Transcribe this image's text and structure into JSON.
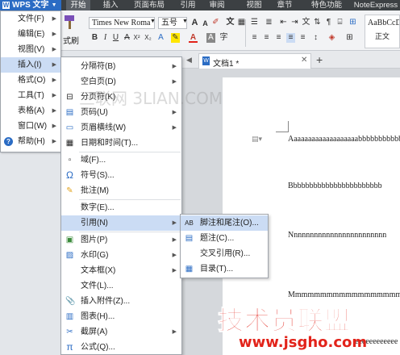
{
  "app": {
    "name": "WPS 文字",
    "logo": "W"
  },
  "ribbon_tabs": [
    "开始",
    "插入",
    "页面布局",
    "引用",
    "审阅",
    "视图",
    "章节",
    "特色功能",
    "NoteExpress"
  ],
  "toolbar": {
    "font": "Times New Roma",
    "size": "五号",
    "format_painter": "式刷",
    "style_name": "AaBbCcD",
    "style_label": "正文"
  },
  "main_menu": [
    {
      "label": "文件(F)",
      "arrow": true
    },
    {
      "label": "编辑(E)",
      "arrow": true
    },
    {
      "label": "视图(V)",
      "arrow": true
    },
    {
      "label": "插入(I)",
      "arrow": true,
      "active": true
    },
    {
      "label": "格式(O)",
      "arrow": true
    },
    {
      "label": "工具(T)",
      "arrow": true
    },
    {
      "label": "表格(A)",
      "arrow": true
    },
    {
      "label": "窗口(W)",
      "arrow": true
    },
    {
      "label": "帮助(H)",
      "arrow": true
    }
  ],
  "insert_menu": [
    {
      "label": "分隔符(B)",
      "arrow": true,
      "icon": ""
    },
    {
      "label": "空白页(D)",
      "arrow": true,
      "icon": ""
    },
    {
      "label": "分页符(K)",
      "arrow": false,
      "icon": "page-break-icon"
    },
    {
      "label": "页码(U)",
      "arrow": true,
      "icon": "page-number-icon"
    },
    {
      "label": "页眉横线(W)",
      "arrow": true,
      "icon": "header-line-icon"
    },
    {
      "label": "日期和时间(T)...",
      "arrow": false,
      "icon": "datetime-icon"
    },
    {
      "label": "域(F)...",
      "arrow": false,
      "icon": "field-icon"
    },
    {
      "label": "符号(S)...",
      "arrow": false,
      "icon": "omega-icon"
    },
    {
      "label": "批注(M)",
      "arrow": false,
      "icon": "comment-icon"
    },
    {
      "label": "数字(E)...",
      "arrow": false,
      "icon": ""
    },
    {
      "label": "引用(N)",
      "arrow": true,
      "icon": "",
      "active": true
    },
    {
      "label": "图片(P)",
      "arrow": true,
      "icon": "picture-icon"
    },
    {
      "label": "水印(G)",
      "arrow": true,
      "icon": "watermark-icon"
    },
    {
      "label": "文本框(X)",
      "arrow": true,
      "icon": ""
    },
    {
      "label": "文件(L)...",
      "arrow": false,
      "icon": ""
    },
    {
      "label": "插入附件(Z)...",
      "arrow": false,
      "icon": "attachment-icon"
    },
    {
      "label": "图表(H)...",
      "arrow": false,
      "icon": "chart-icon"
    },
    {
      "label": "截屏(A)",
      "arrow": true,
      "icon": "screenshot-icon"
    },
    {
      "label": "公式(Q)...",
      "arrow": false,
      "icon": "formula-icon"
    }
  ],
  "reference_menu": [
    {
      "label": "脚注和尾注(O)...",
      "icon": "footnote-icon",
      "active": true
    },
    {
      "label": "题注(C)...",
      "icon": "caption-icon"
    },
    {
      "label": "交叉引用(R)...",
      "icon": ""
    },
    {
      "label": "目录(T)...",
      "icon": "toc-icon"
    }
  ],
  "document": {
    "tab_title": "文档1 *",
    "lines": [
      "Aaaaaaaaaaaaaaaaaaabbbbbbbbbbbbbbbbbb",
      "Bbbbbbbbbbbbbbbbbbbbbbb",
      "Nnnnnnnnnnnnnnnnnnnnnnnn",
      "Mmmmmmmmmmmmmmmmmmmmm",
      "eeeeeeeeeeee"
    ]
  },
  "watermarks": {
    "top": "三联网 3LIAN.COM",
    "bottom_cn": "技术员联盟",
    "bottom_url": "www.jsgho.com"
  },
  "colors": {
    "wps_blue": "#2b6cc4",
    "menu_highlight": "#cbdcf4",
    "watermark_red": "#e2231a"
  }
}
